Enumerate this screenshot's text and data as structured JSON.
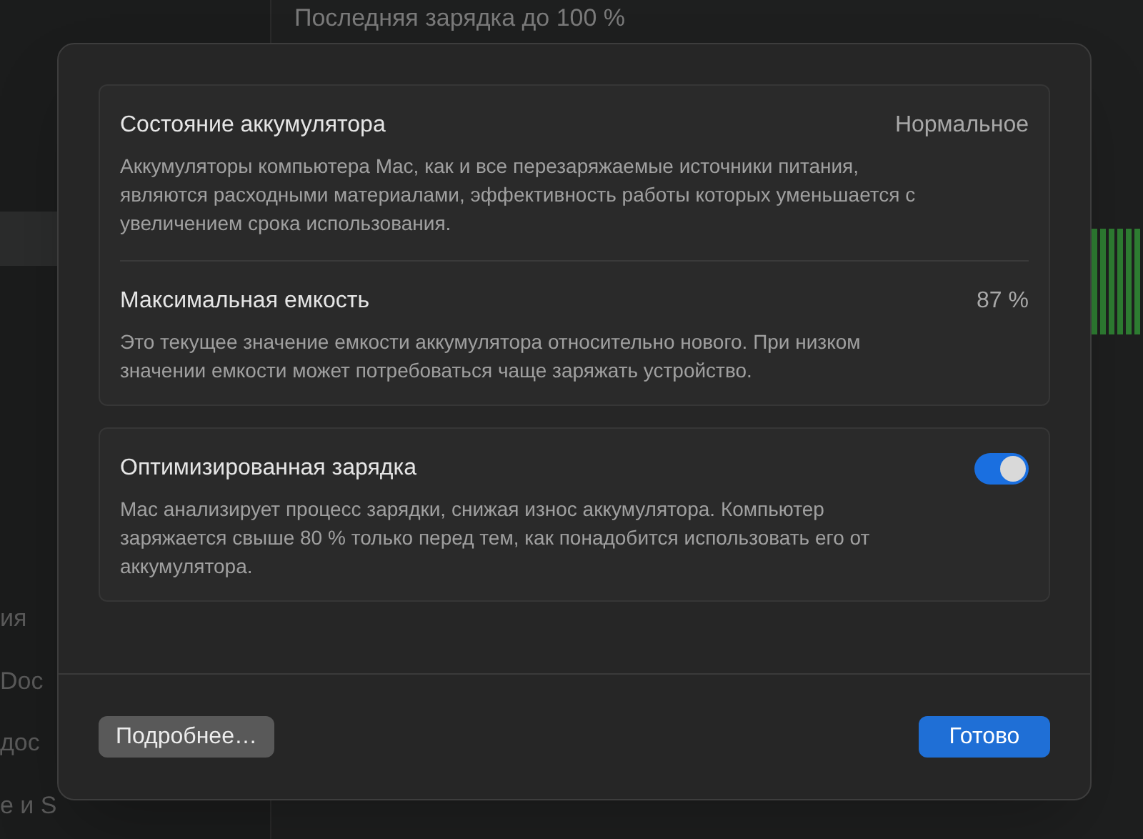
{
  "background": {
    "header_text": "Последняя зарядка до 100 %",
    "sidebar_items": [
      {
        "label": "ия"
      },
      {
        "label": "Doc"
      },
      {
        "label": "дос"
      },
      {
        "label": "е и S"
      }
    ]
  },
  "dialog": {
    "sections": [
      {
        "kind": "info",
        "title": "Состояние аккумулятора",
        "value": "Нормальное",
        "description": "Аккумуляторы компьютера Mac, как и все перезаряжаемые источники питания, являются расходными материалами, эффективность работы которых уменьшается с увеличением срока использования."
      },
      {
        "kind": "info",
        "title": "Максимальная емкость",
        "value": "87 %",
        "description": "Это текущее значение емкости аккумулятора относительно нового. При низком значении емкости может потребоваться чаще заряжать устройство."
      },
      {
        "kind": "toggle",
        "title": "Оптимизированная зарядка",
        "on": true,
        "description": "Mac анализирует процесс зарядки, снижая износ аккумулятора. Компьютер заряжается свыше 80 % только перед тем, как понадобится использовать его от аккумулятора."
      }
    ],
    "buttons": [
      {
        "label": "Подробнее…",
        "kind": "secondary"
      },
      {
        "label": "Готово",
        "kind": "primary"
      }
    ]
  }
}
